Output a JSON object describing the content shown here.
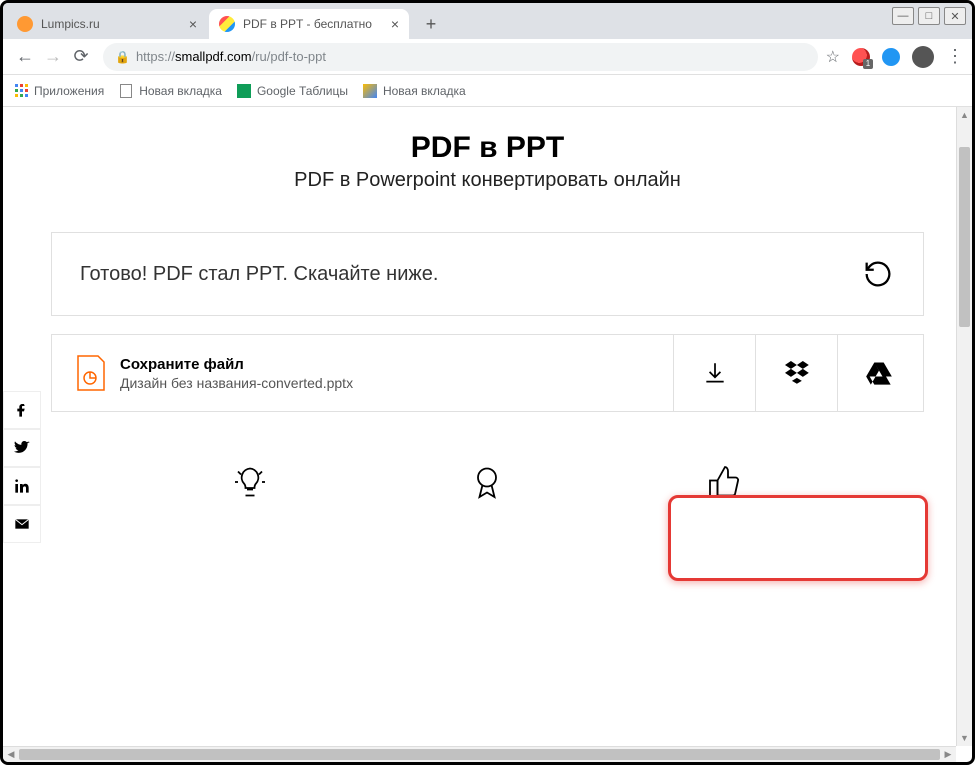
{
  "window": {
    "minimize": "—",
    "maximize": "□",
    "close": "✕"
  },
  "tabs": [
    {
      "title": "Lumpics.ru",
      "active": false
    },
    {
      "title": "PDF в PPT - бесплатно",
      "active": true
    }
  ],
  "url": {
    "scheme": "https://",
    "host": "smallpdf.com",
    "path": "/ru/pdf-to-ppt"
  },
  "ext_badge": "1",
  "bookmarks": [
    {
      "label": "Приложения"
    },
    {
      "label": "Новая вкладка"
    },
    {
      "label": "Google Таблицы"
    },
    {
      "label": "Новая вкладка"
    }
  ],
  "page": {
    "title": "PDF в PPT",
    "subtitle": "PDF в Powerpoint конвертировать онлайн",
    "done_msg": "Готово! PDF стал PPT. Скачайте ниже.",
    "save_title": "Сохраните файл",
    "filename": "Дизайн без названия-converted.pptx"
  },
  "social": [
    "f",
    "t",
    "in",
    "m"
  ],
  "bottom": [
    "bulb",
    "ribbon",
    "thumbs"
  ]
}
